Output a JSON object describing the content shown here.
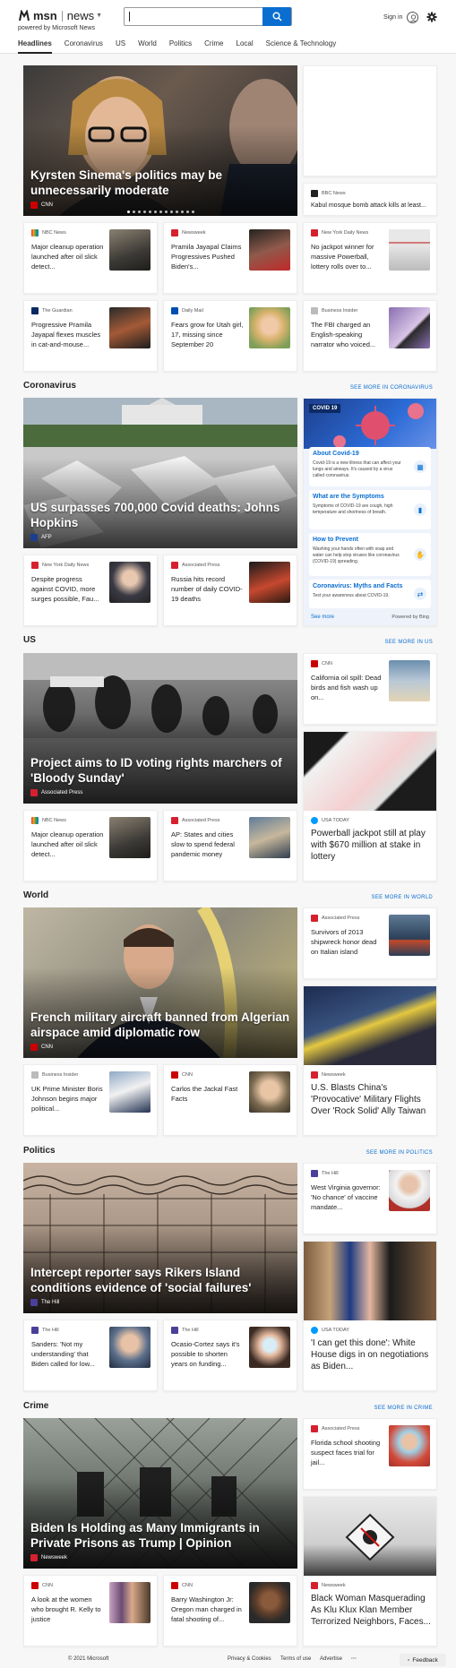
{
  "header": {
    "brand": "msn",
    "section": "news",
    "powered_by": "powered by Microsoft News",
    "search_value": "",
    "sign_in": "Sign in"
  },
  "nav": [
    "Headlines",
    "Coronavirus",
    "US",
    "World",
    "Politics",
    "Crime",
    "Local",
    "Science & Technology"
  ],
  "colors": {
    "accent": "#0a6ed1",
    "cnn": "#cc0000",
    "newsweek": "#d6202e"
  },
  "headlines": {
    "hero": {
      "title": "Kyrsten Sinema's politics may be unnecessarily moderate",
      "source": "CNN"
    },
    "side_top": {
      "source": "",
      "title": ""
    },
    "side_bbc": {
      "source": "BBC News",
      "title": "Kabul mosque bomb attack kills at least..."
    },
    "cards": [
      {
        "source": "NBC News",
        "title": "Major cleanup operation launched after oil slick detect..."
      },
      {
        "source": "Newsweek",
        "title": "Pramila Jayapal Claims Progressives Pushed Biden's..."
      },
      {
        "source": "New York Daily News",
        "title": "No jackpot winner for massive Powerball, lottery rolls over to..."
      },
      {
        "source": "The Guardian",
        "title": "Progressive Pramila Jayapal flexes muscles in cat-and-mouse..."
      },
      {
        "source": "Daily Mail",
        "title": "Fears grow for Utah girl, 17, missing since September 20"
      },
      {
        "source": "Business Insider",
        "title": "The FBI charged an English-speaking narrator who voiced..."
      }
    ]
  },
  "coronavirus": {
    "title": "Coronavirus",
    "see_more": "SEE MORE IN CORONAVIRUS",
    "hero": {
      "title": "US surpasses 700,000 Covid deaths: Johns Hopkins",
      "source": "AFP"
    },
    "cards": [
      {
        "source": "New York Daily News",
        "title": "Despite progress against COVID, more surges possible, Fau..."
      },
      {
        "source": "Associated Press",
        "title": "Russia hits record number of daily COVID-19 deaths"
      }
    ],
    "widget": {
      "tag": "COVID 19",
      "items": [
        {
          "title": "About Covid-19",
          "text": "Covid-19 is a new illness that can affect your lungs and airways. It's caused by a virus called coronavirus."
        },
        {
          "title": "What are the Symptoms",
          "text": "Symptoms of COVID-19 are cough, high temperature and shortness of breath."
        },
        {
          "title": "How to Prevent",
          "text": "Washing your hands often with soap and water can help stop viruses like coronavirus (COVID-19) spreading."
        },
        {
          "title": "Coronavirus: Myths and Facts",
          "text": "Test your awareness about COVID-19."
        }
      ],
      "see_more": "See more",
      "powered": "Powered by Bing"
    }
  },
  "us": {
    "title": "US",
    "see_more": "SEE MORE IN US",
    "hero": {
      "title": "Project aims to ID voting rights marchers of 'Bloody Sunday'",
      "source": "Associated Press"
    },
    "side": {
      "source": "CNN",
      "title": "California oil spill: Dead birds and fish wash up on..."
    },
    "big": {
      "source": "USA TODAY",
      "title": "Powerball jackpot still at play with $670 million at stake in lottery"
    },
    "cards": [
      {
        "source": "NBC News",
        "title": "Major cleanup operation launched after oil slick detect..."
      },
      {
        "source": "Associated Press",
        "title": "AP: States and cities slow to spend federal pandemic money"
      }
    ]
  },
  "world": {
    "title": "World",
    "see_more": "SEE MORE IN WORLD",
    "hero": {
      "title": "French military aircraft banned from Algerian airspace amid diplomatic row",
      "source": "CNN"
    },
    "side": {
      "source": "Associated Press",
      "title": "Survivors of 2013 shipwreck honor dead on Italian island"
    },
    "big": {
      "source": "Newsweek",
      "title": "U.S. Blasts China's 'Provocative' Military Flights Over 'Rock Solid' Ally Taiwan"
    },
    "cards": [
      {
        "source": "Business Insider",
        "title": "UK Prime Minister Boris Johnson begins major political..."
      },
      {
        "source": "CNN",
        "title": "Carlos the Jackal Fast Facts"
      }
    ]
  },
  "politics": {
    "title": "Politics",
    "see_more": "SEE MORE IN POLITICS",
    "hero": {
      "title": "Intercept reporter says Rikers Island conditions evidence of 'social failures'",
      "source": "The Hill"
    },
    "side": {
      "source": "The Hill",
      "title": "West Virginia governor: 'No chance' of vaccine mandate..."
    },
    "big": {
      "source": "USA TODAY",
      "title": "'I can get this done': White House digs in on negotiations as Biden..."
    },
    "cards": [
      {
        "source": "The Hill",
        "title": "Sanders: 'Not my understanding' that Biden called for low..."
      },
      {
        "source": "The Hill",
        "title": "Ocasio-Cortez says it's possible to shorten years on funding..."
      }
    ]
  },
  "crime": {
    "title": "Crime",
    "see_more": "SEE MORE IN CRIME",
    "hero": {
      "title": "Biden Is Holding as Many Immigrants in Private Prisons as Trump | Opinion",
      "source": "Newsweek"
    },
    "side": {
      "source": "Associated Press",
      "title": "Florida school shooting suspect faces trial for jail..."
    },
    "big": {
      "source": "Newsweek",
      "title": "Black Woman Masquerading As Klu Klux Klan Member Terrorized Neighbors, Faces..."
    },
    "cards": [
      {
        "source": "CNN",
        "title": "A look at the women who brought R. Kelly to justice"
      },
      {
        "source": "CNN",
        "title": "Barry Washington Jr: Oregon man charged in fatal shooting of..."
      }
    ]
  },
  "footer": {
    "copyright": "© 2021 Microsoft",
    "links": [
      "Privacy & Cookies",
      "Terms of use",
      "Advertise"
    ],
    "more": "···",
    "feedback": "Feedback"
  }
}
